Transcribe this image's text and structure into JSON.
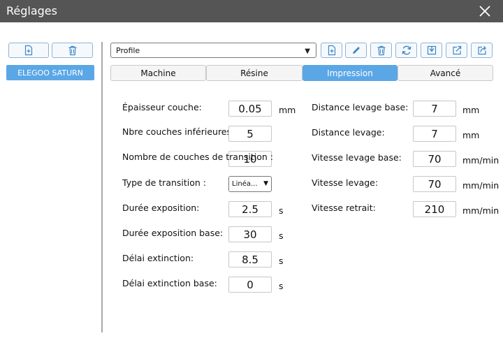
{
  "window": {
    "title": "Réglages"
  },
  "sidebar": {
    "items": [
      {
        "label": "ELEGOO SATURN"
      }
    ]
  },
  "profile": {
    "selected": "Profile"
  },
  "tabs": [
    {
      "label": "Machine"
    },
    {
      "label": "Résine"
    },
    {
      "label": "Impression"
    },
    {
      "label": "Avancé"
    }
  ],
  "active_tab": "Impression",
  "left_fields": [
    {
      "label": "Épaisseur couche:",
      "value": "0.05",
      "unit": "mm"
    },
    {
      "label": "Nbre couches inférieures:",
      "value": "5",
      "unit": ""
    },
    {
      "label": "Nombre de couches de transition :",
      "value": "10",
      "unit": ""
    },
    {
      "label": "Type de transition :",
      "value": "Linéa...",
      "unit": ""
    },
    {
      "label": "Durée exposition:",
      "value": "2.5",
      "unit": "s"
    },
    {
      "label": "Durée exposition base:",
      "value": "30",
      "unit": "s"
    },
    {
      "label": "Délai extinction:",
      "value": "8.5",
      "unit": "s"
    },
    {
      "label": "Délai extinction base:",
      "value": "0",
      "unit": "s"
    }
  ],
  "right_fields": [
    {
      "label": "Distance levage base:",
      "value": "7",
      "unit": "mm"
    },
    {
      "label": "Distance levage:",
      "value": "7",
      "unit": "mm"
    },
    {
      "label": "Vitesse levage base:",
      "value": "70",
      "unit": "mm/min"
    },
    {
      "label": "Vitesse levage:",
      "value": "70",
      "unit": "mm/min"
    },
    {
      "label": "Vitesse retrait:",
      "value": "210",
      "unit": "mm/min"
    }
  ],
  "icons": {
    "sidebar": [
      "add-file-icon",
      "trash-icon"
    ],
    "toolbar": [
      "add-file-icon",
      "pencil-icon",
      "trash-icon",
      "refresh-icon",
      "import-icon",
      "export-icon",
      "share-icon"
    ]
  },
  "colors": {
    "titlebar": "#555555",
    "accent": "#5ba7e6",
    "icon": "#3c87c9"
  }
}
